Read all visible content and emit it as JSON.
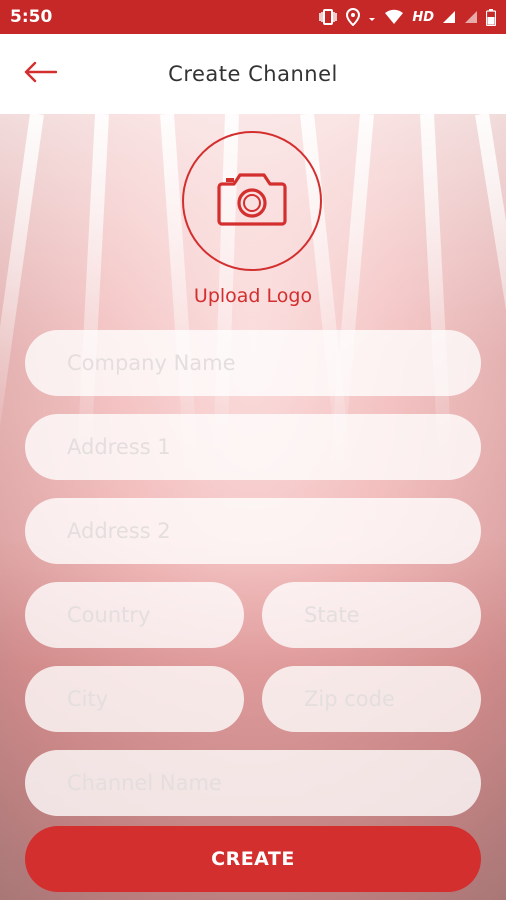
{
  "status_bar": {
    "time": "5:50",
    "network_label": "HD"
  },
  "app_bar": {
    "title": "Create Channel",
    "back_icon": "arrow-left-icon"
  },
  "upload": {
    "label": "Upload Logo",
    "icon": "camera-icon"
  },
  "form": {
    "company_name": {
      "placeholder": "Company Name",
      "value": ""
    },
    "address1": {
      "placeholder": "Address 1",
      "value": ""
    },
    "address2": {
      "placeholder": "Address 2",
      "value": ""
    },
    "country": {
      "placeholder": "Country",
      "value": ""
    },
    "state": {
      "placeholder": "State",
      "value": ""
    },
    "city": {
      "placeholder": "City",
      "value": ""
    },
    "zip": {
      "placeholder": "Zip code",
      "value": ""
    },
    "channel_name": {
      "placeholder": "Channel Name",
      "value": ""
    }
  },
  "actions": {
    "create_label": "CREATE"
  },
  "colors": {
    "accent": "#d32f2f",
    "status_bar": "#c62828"
  }
}
